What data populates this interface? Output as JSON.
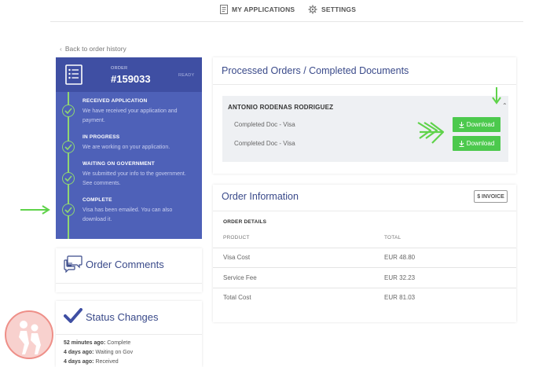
{
  "nav": {
    "my_applications": "MY APPLICATIONS",
    "settings": "SETTINGS"
  },
  "back_link": "Back to order history",
  "order": {
    "label": "ORDER",
    "number": "#159033",
    "status": "READY"
  },
  "timeline": [
    {
      "title": "RECEIVED APPLICATION",
      "desc": "We have received your application and payment."
    },
    {
      "title": "IN PROGRESS",
      "desc": "We are working on your application."
    },
    {
      "title": "WAITING ON GOVERNMENT",
      "desc": "We submitted your info to the government. See comments."
    },
    {
      "title": "COMPLETE",
      "desc": "Visa has been emailed. You can also download it."
    }
  ],
  "comments_card": {
    "title": "Order Comments"
  },
  "status_changes": {
    "title": "Status Changes",
    "items": [
      {
        "when": "52 minutes ago:",
        "status": "Complete"
      },
      {
        "when": "4 days ago:",
        "status": "Waiting on Gov"
      },
      {
        "when": "4 days ago:",
        "status": "Received"
      }
    ]
  },
  "processed": {
    "title": "Processed Orders / Completed Documents",
    "applicant": "ANTONIO RODENAS RODRIGUEZ",
    "documents": [
      {
        "name": "Completed Doc - Visa",
        "button": "Download"
      },
      {
        "name": "Completed Doc - Visa",
        "button": "Download"
      }
    ]
  },
  "order_info": {
    "title": "Order Information",
    "invoice_button": "$ INVOICE",
    "details_label": "ORDER DETAILS",
    "columns": [
      "PRODUCT",
      "TOTAL"
    ],
    "rows": [
      {
        "product": "Visa Cost",
        "total": "EUR 48.80"
      },
      {
        "product": "Service Fee",
        "total": "EUR 32.23"
      },
      {
        "product": "Total Cost",
        "total": "EUR 81.03"
      }
    ]
  },
  "colors": {
    "primary_blue": "#4e61b8",
    "header_blue": "#3f4fa3",
    "download_green": "#4cc94d",
    "timeline_green": "#8fd672",
    "annotation_green": "#5fd34a"
  },
  "icons": [
    "document-icon",
    "gear-icon",
    "checkmark-icon",
    "chat-bubbles-icon",
    "download-icon",
    "caret-up-icon"
  ]
}
